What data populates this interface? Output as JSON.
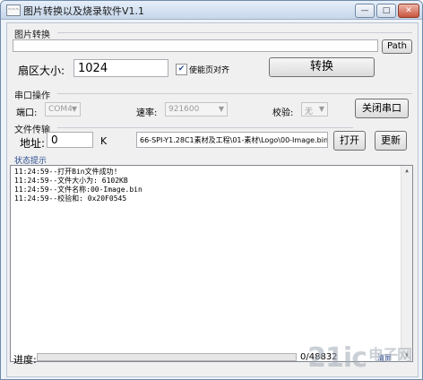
{
  "window": {
    "title": "图片转换以及烧录软件V1.1",
    "icon_text": "~~~",
    "minimize": "—",
    "maximize": "□",
    "close": "✕"
  },
  "image_convert": {
    "section": "图片转换",
    "path_value": "",
    "path_button": "Path",
    "sector_label": "扇区大小:",
    "sector_value": "1024",
    "align_checked": true,
    "align_label": "使能页对齐",
    "convert_button": "转换"
  },
  "serial": {
    "section": "串口操作",
    "port_label": "端口:",
    "port_value": "COM4",
    "baud_label": "速率:",
    "baud_value": "921600",
    "parity_label": "校验:",
    "parity_value": "无",
    "close_button": "关闭串口"
  },
  "transfer": {
    "section": "文件传输",
    "address_label": "地址:",
    "address_value": "0",
    "unit": "K",
    "file_path": "66-SPI-Y1.28C1素材及工程\\01-素材\\Logo\\00-Image.bin",
    "open_button": "打开",
    "update_button": "更新"
  },
  "status": {
    "section": "状态提示",
    "lines": [
      "11:24:59--打开Bin文件成功!",
      "11:24:59--文件大小为: 6102KB",
      "11:24:59--文件名称:00-Image.bin",
      "11:24:59--校验和: 0x20F0545"
    ]
  },
  "progress": {
    "label": "进度:",
    "value_text": "0/48832",
    "fraction": 0,
    "clear_button": "清屏",
    "color": "#7fc77f"
  },
  "watermark": {
    "text": "21ic",
    "sub": "电子网"
  },
  "colors": {
    "titlebar": "#c6d6ea",
    "accent": "#2a4c8f"
  }
}
